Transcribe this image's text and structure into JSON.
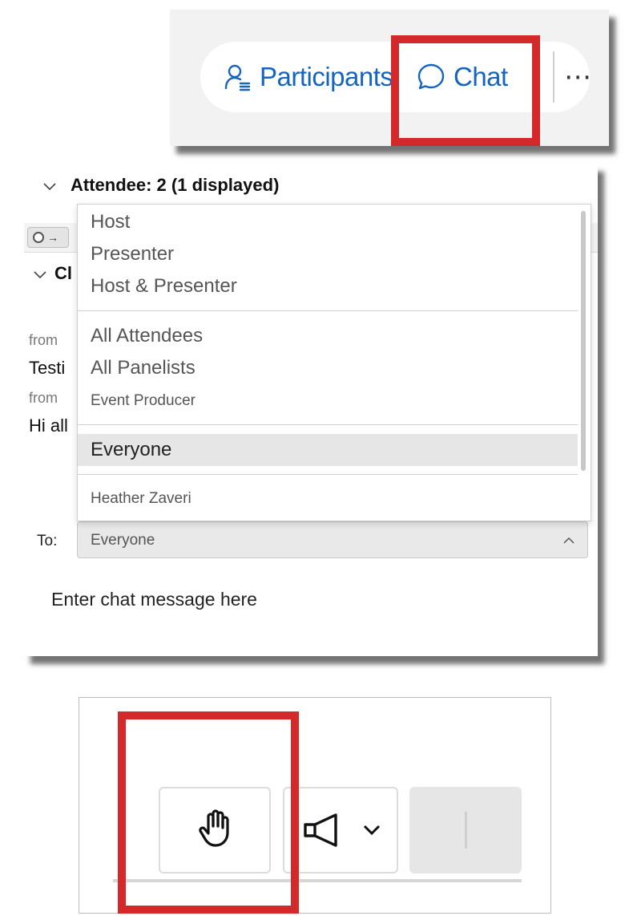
{
  "toolbar": {
    "participants_label": "Participants",
    "chat_label": "Chat",
    "more_label": "⋯",
    "accent_color": "#1565c0",
    "icons": [
      "participants-icon",
      "chat-bubble-icon",
      "more-icon"
    ]
  },
  "chat_panel": {
    "attendee_header": "Attendee: 2 (1 displayed)",
    "chat_section_header": "Cl",
    "messages": [
      {
        "from": "from",
        "text": "Testi"
      },
      {
        "from": "from",
        "text": "Hi all"
      }
    ],
    "to_label": "To:",
    "to_selected": "Everyone",
    "chat_placeholder": "Enter chat message here"
  },
  "recipient_dropdown": {
    "groups": [
      [
        "Host",
        "Presenter",
        "Host & Presenter"
      ],
      [
        "All Attendees",
        "All Panelists",
        "Event Producer"
      ],
      [
        "Everyone"
      ],
      [
        "Heather Zaveri"
      ]
    ],
    "selected": "Everyone"
  },
  "controls": {
    "icons": [
      "raise-hand-icon",
      "megaphone-icon",
      "chevron-down-icon"
    ]
  },
  "highlight_color": "#d3292b"
}
